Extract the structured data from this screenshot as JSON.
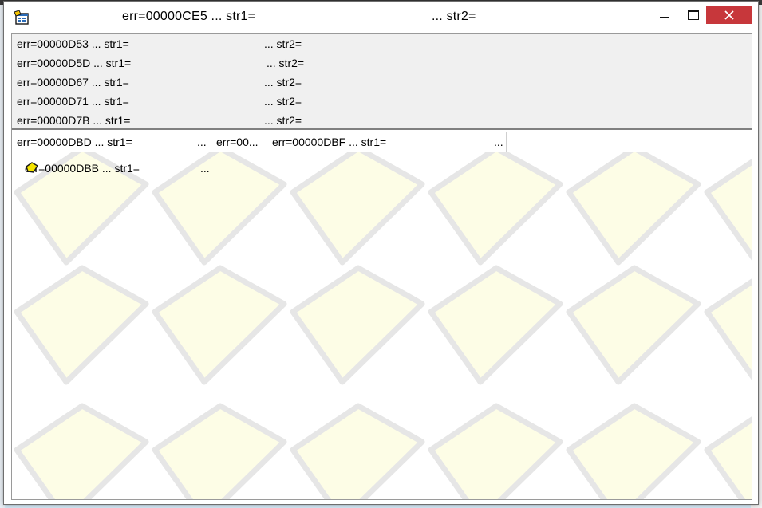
{
  "window": {
    "title_left": "err=00000CE5 ... str1=",
    "title_right": "... str2="
  },
  "error_list": [
    {
      "left": "err=00000D53 ... str1=",
      "right": "... str2="
    },
    {
      "left": "err=00000D5D ... str1=",
      "right": "... str2="
    },
    {
      "left": "err=00000D67 ... str1=",
      "right": "... str2="
    },
    {
      "left": "err=00000D71 ... str1=",
      "right": "... str2="
    },
    {
      "left": "err=00000D7B ... str1=",
      "right": "... str2="
    }
  ],
  "tabs": [
    {
      "label": "err=00000DBD ... str1=",
      "ellipsis": "..."
    },
    {
      "label": "err=00...",
      "ellipsis": ""
    },
    {
      "label": "err=00000DBF ... str1=",
      "ellipsis": "..."
    }
  ],
  "tree_node": {
    "label": "err=00000DBB ... str1=",
    "ellipsis": "...",
    "icon": "yellow-diamond-icon"
  },
  "icons": {
    "app": "app-window-icon",
    "minimize": "minimize-icon",
    "maximize": "maximize-icon",
    "close": "close-icon"
  },
  "colors": {
    "close_button": "#c7373b",
    "list_background": "#f0f0f0",
    "tile_fill": "#fdfde6",
    "tile_stroke": "#e6e6e6",
    "node_icon_fill": "#f5e400"
  }
}
